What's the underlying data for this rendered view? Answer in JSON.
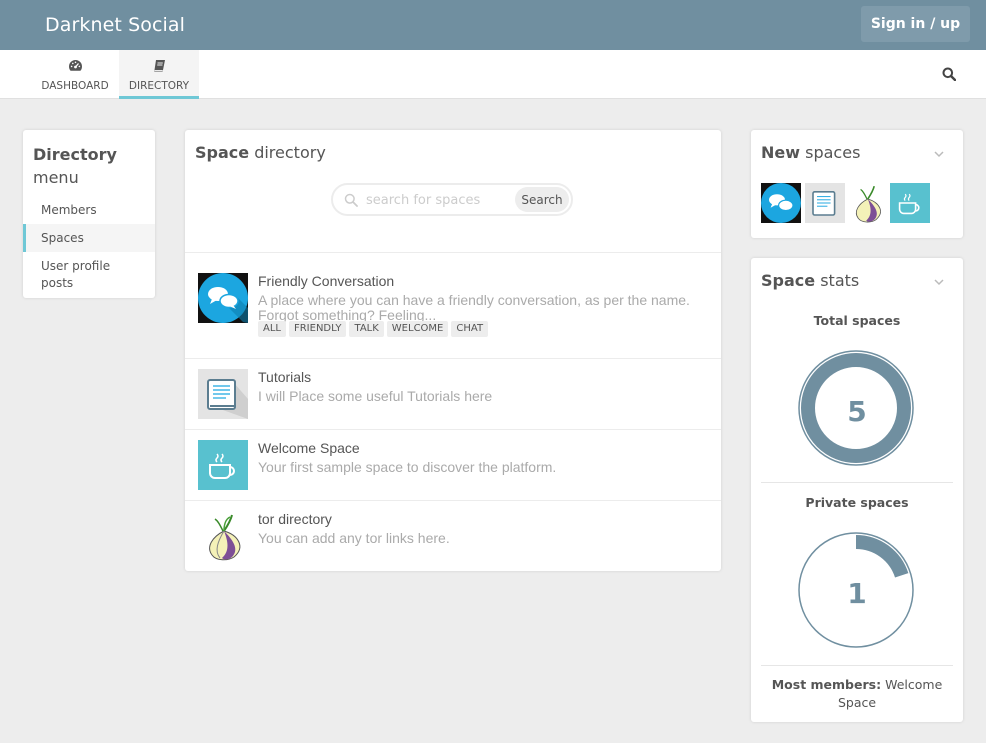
{
  "app": {
    "brand": "Darknet Social",
    "signin_label": "Sign in / up"
  },
  "nav": {
    "tabs": [
      {
        "label": "DASHBOARD",
        "icon": "dashboard-icon",
        "active": false
      },
      {
        "label": "DIRECTORY",
        "icon": "book-icon",
        "active": true
      }
    ],
    "search_icon": "search-icon"
  },
  "menu": {
    "title_bold": "Directory",
    "title_light": "menu",
    "items": [
      {
        "label": "Members",
        "active": false
      },
      {
        "label": "Spaces",
        "active": true
      },
      {
        "label": "User profile posts",
        "active": false
      }
    ]
  },
  "directory": {
    "title_bold": "Space",
    "title_light": "directory",
    "search_placeholder": "search for spaces",
    "search_button": "Search",
    "spaces": [
      {
        "name": "Friendly Conversation",
        "description": "A place where you can have a friendly conversation, as per the name. Forgot something? Feeling...",
        "icon": "chat-bubbles-icon",
        "tags": [
          "ALL",
          "FRIENDLY",
          "TALK",
          "WELCOME",
          "CHAT"
        ]
      },
      {
        "name": "Tutorials",
        "description": "I will Place some useful Tutorials here",
        "icon": "document-icon",
        "tags": []
      },
      {
        "name": "Welcome Space",
        "description": "Your first sample space to discover the platform.",
        "icon": "coffee-cup-icon",
        "tags": []
      },
      {
        "name": "tor directory",
        "description": "You can add any tor links here.",
        "icon": "onion-icon",
        "tags": []
      }
    ]
  },
  "new_spaces": {
    "title_bold": "New",
    "title_light": "spaces",
    "icons": [
      "chat-bubbles-icon",
      "document-icon",
      "onion-icon",
      "coffee-cup-icon"
    ]
  },
  "stats": {
    "title_bold": "Space",
    "title_light": "stats",
    "total_label": "Total spaces",
    "total_value": "5",
    "total_fraction": 1.0,
    "private_label": "Private spaces",
    "private_value": "1",
    "private_fraction": 0.2,
    "most_members_label": "Most members:",
    "most_members_value": "Welcome Space"
  },
  "colors": {
    "topbar": "#708fa0",
    "accent": "#6fc8d6",
    "donut": "#708fa0",
    "chat_icon_bg": "#1ca6e0",
    "welcome_icon_bg": "#58c1cf"
  }
}
